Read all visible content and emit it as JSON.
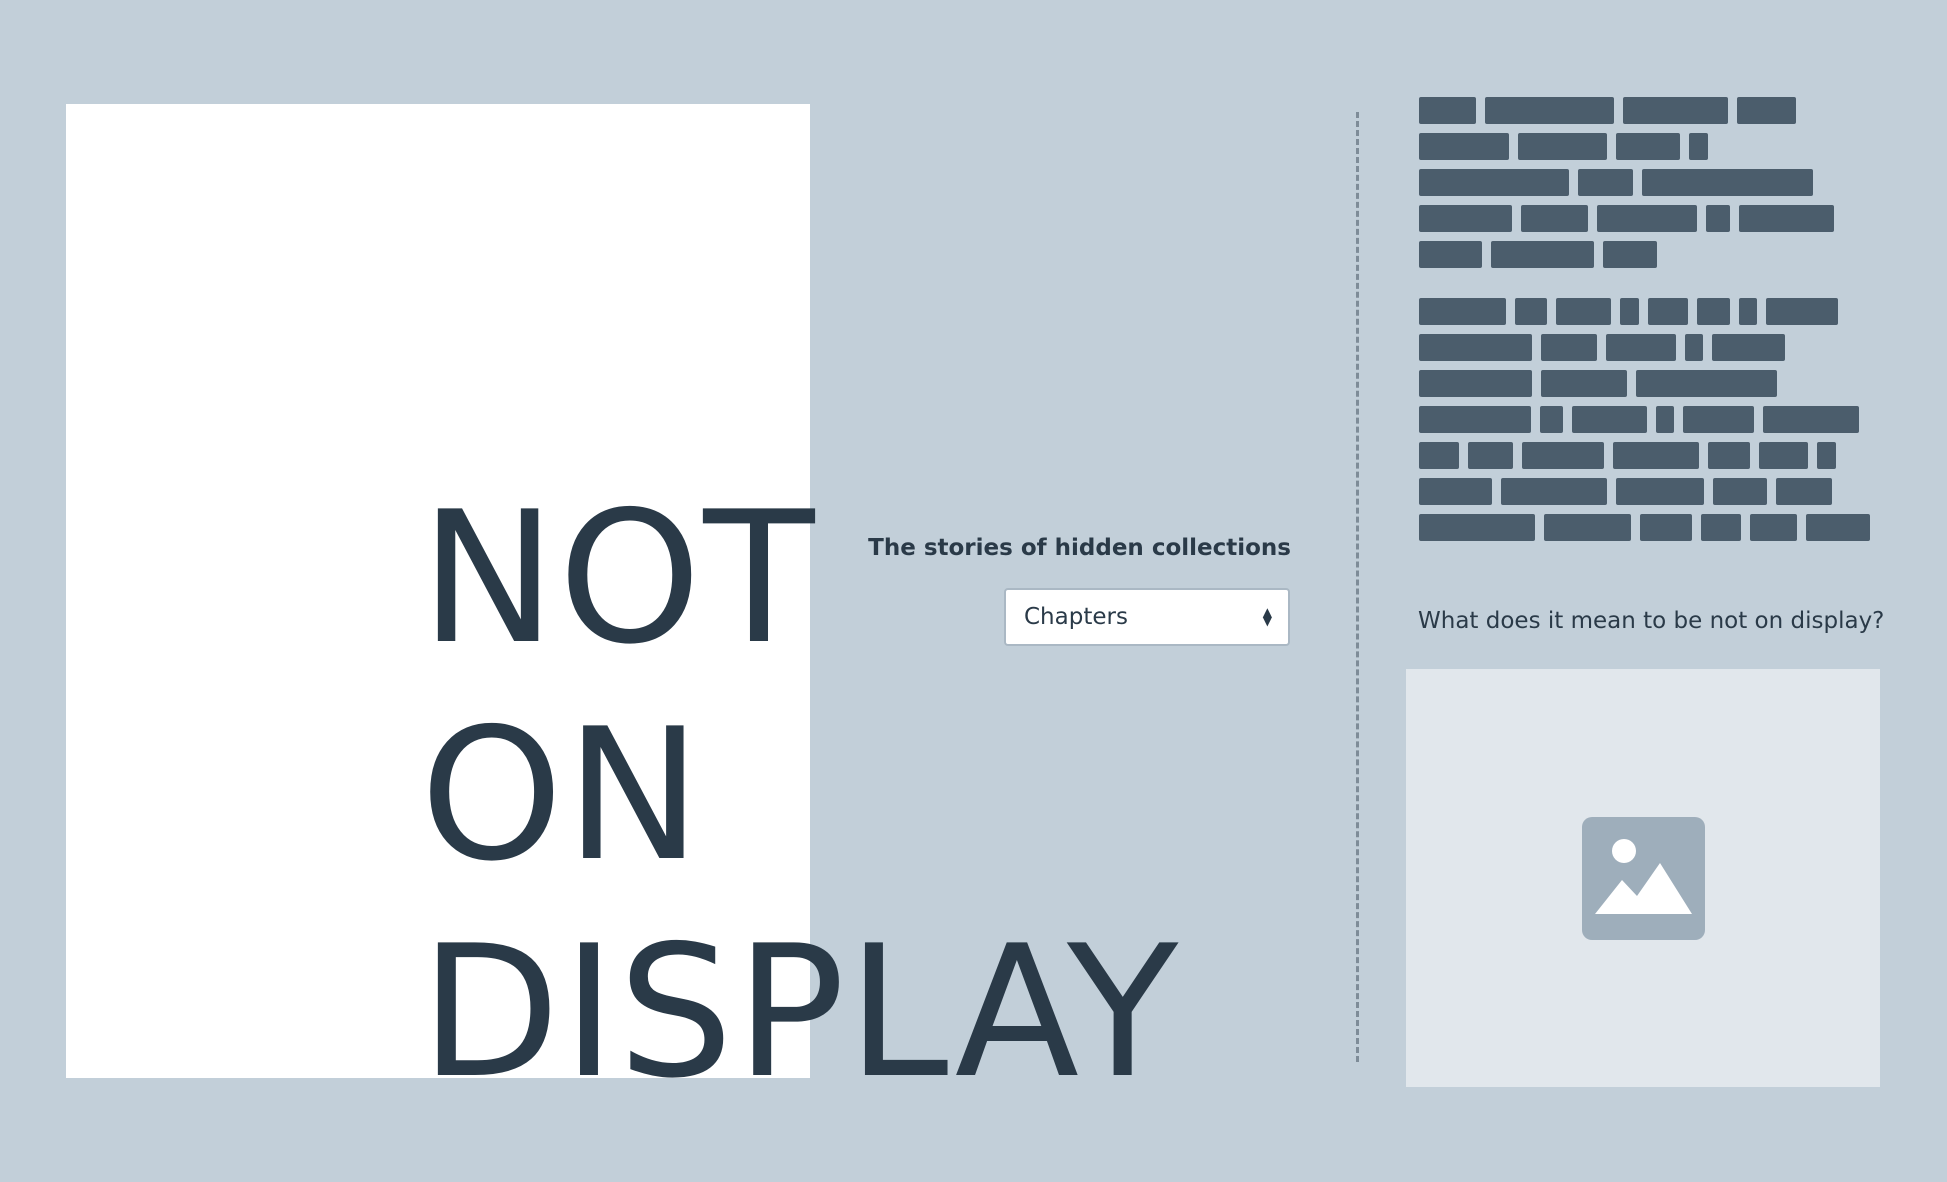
{
  "hero": {
    "line1": "NOT",
    "line2": "ON",
    "line3": "DISPLAY"
  },
  "collections": {
    "label": "The stories of hidden collections",
    "select_value": "Chapters"
  },
  "sidebar": {
    "question": "What does it mean to be not on display?",
    "image_icon": "image-placeholder-icon"
  },
  "colors": {
    "background": "#c2cfd9",
    "panel": "#ffffff",
    "text": "#2a3a48",
    "redacted_block": "#4b5d6c",
    "image_bg": "#e1e7ec",
    "image_icon": "#9eaebb"
  }
}
